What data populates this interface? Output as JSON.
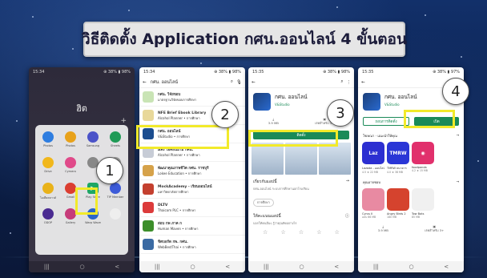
{
  "banner": {
    "title": "วิธีติดตั้ง Application กศน.ออนไลน์ 4 ขั้นตอน"
  },
  "steps": [
    "1",
    "2",
    "3",
    "4"
  ],
  "phone1": {
    "status_time": "15:34",
    "status_right": "⊕ 38% ▮ 98%",
    "folder_title": "ฮิต",
    "apps": [
      {
        "label": "Photos",
        "color": "#2e7de0"
      },
      {
        "label": "Photos",
        "color": "#e8a21b"
      },
      {
        "label": "Samsung",
        "color": "#4b53c8"
      },
      {
        "label": "Sheets",
        "color": "#1f9a56"
      },
      {
        "label": "Drive",
        "color": "#f1b71c"
      },
      {
        "label": "Cymera",
        "color": "#e04a8a"
      },
      {
        "label": "",
        "color": "#888"
      },
      {
        "label": "",
        "color": "#999"
      },
      {
        "label": "ไอเดียคลาวด์",
        "color": "#e9b21a"
      },
      {
        "label": "Gmail",
        "color": "#db3e31"
      },
      {
        "label": "Play Store",
        "color": "#1ea765"
      },
      {
        "label": "TIP Member",
        "color": "#3d5bd8"
      },
      {
        "label": "ODOP",
        "color": "#4a2a91"
      },
      {
        "label": "Gallery",
        "color": "#c63c7a"
      },
      {
        "label": "Warp Wave",
        "color": "#2b66c9"
      },
      {
        "label": "",
        "color": "#eee"
      }
    ]
  },
  "phone2": {
    "status_time": "15:34",
    "status_right": "⊕ 38% ▮ 98%",
    "search_query": "กศน. ออนไลน์",
    "results": [
      {
        "name": "กศน. วิจัยขอบ",
        "sub": "มาตรฐานวิจัยขอบการศึกษา",
        "color": "#c9e4b5"
      },
      {
        "name": "NFE Brief Ebook Library",
        "sub": "Alcohol Planner • การศึกษา",
        "color": "#e8d89a"
      },
      {
        "name": "กศน. ออนไลน์",
        "sub": "V&Studio • การศึกษา",
        "color": "#1b4d8f"
      },
      {
        "name": "ARI ไอคอนมาม กศน.",
        "sub": "Alcohol Planner • การศึกษา",
        "color": "#c7ccd6"
      },
      {
        "name": "พัฒนาคุณภาพชีวิต กศน. ราชบุรี",
        "sub": "Lokee Education • การศึกษา",
        "color": "#d6a24a"
      },
      {
        "name": "MockAcademy - เรียนออนไลน์",
        "sub": "มหาวิทยาลัยการศึกษา",
        "color": "#c4402f"
      },
      {
        "name": "DLTV",
        "sub": "Thaicom PLC • การศึกษา",
        "color": "#dc3b3b"
      },
      {
        "name": "สอบ กพ ภาค ก",
        "sub": "Human Maven • การศึกษา",
        "color": "#3c8e2a"
      },
      {
        "name": "ชิตบอร์ด กพ. กศน.",
        "sub": "WebBestThai • การศึกษา",
        "color": "#3a6aa3"
      }
    ]
  },
  "phone3": {
    "status_time": "15:35",
    "status_right": "⊕ 38% ▮ 98%",
    "app_name": "กศน. ออนไลน์",
    "developer": "V&Studio",
    "stat1": "3.9 MB",
    "stat2": "เรทสำหรับ 3+",
    "install_label": "ติดตั้ง",
    "about_title": "เกี่ยวกับแอปนี้",
    "about_sub": "กศน.ออนไลน์ ระบบการศึกษานอกโรงเรียน",
    "chip": "การศึกษา",
    "rate_title": "ให้คะแนนแอปนี้",
    "rate_sub": "บอกให้คนอื่นๆ รู้ว่าคุณคิดอย่างไร"
  },
  "phone4": {
    "status_time": "15:35",
    "status_right": "⊕ 38% ▮ 97%",
    "app_name": "กศน. ออนไลน์",
    "developer": "V&Studio",
    "uninstall_label": "ถอนการติดตั้ง",
    "open_label": "เปิด",
    "ads_label": "โฆษณา · แนะนำให้คุณ",
    "suggested": [
      {
        "name": "Lazada - ออนไลน์",
        "sub": "4.5 ★ 22 MB",
        "text": "Laz",
        "color": "#2c2fd1"
      },
      {
        "name": "TMRW ธนาคาร",
        "sub": "4.0 ★ 38 MB",
        "text": "TMRW",
        "color": "#2a36d6"
      },
      {
        "name": "foodpanda",
        "sub": "4.2 ★ 15 MB",
        "text": "◉",
        "color": "#e1306c"
      }
    ],
    "may_like": "คุณอาจชอบ",
    "games": [
      {
        "name": "Cyrus II",
        "sub": "ฉบับ 66 MB",
        "color": "#e88aa2"
      },
      {
        "name": "Angry Birds 2",
        "sub": "180 MB",
        "color": "#d5432e"
      },
      {
        "name": "Tow Bots",
        "sub": "85 MB",
        "color": "#f0f0f0"
      }
    ],
    "stat1": "3.9 MB",
    "stat2": "เรทสำหรับ 3+"
  },
  "nav": {
    "recent": "|||",
    "home": "○",
    "back": "<"
  }
}
